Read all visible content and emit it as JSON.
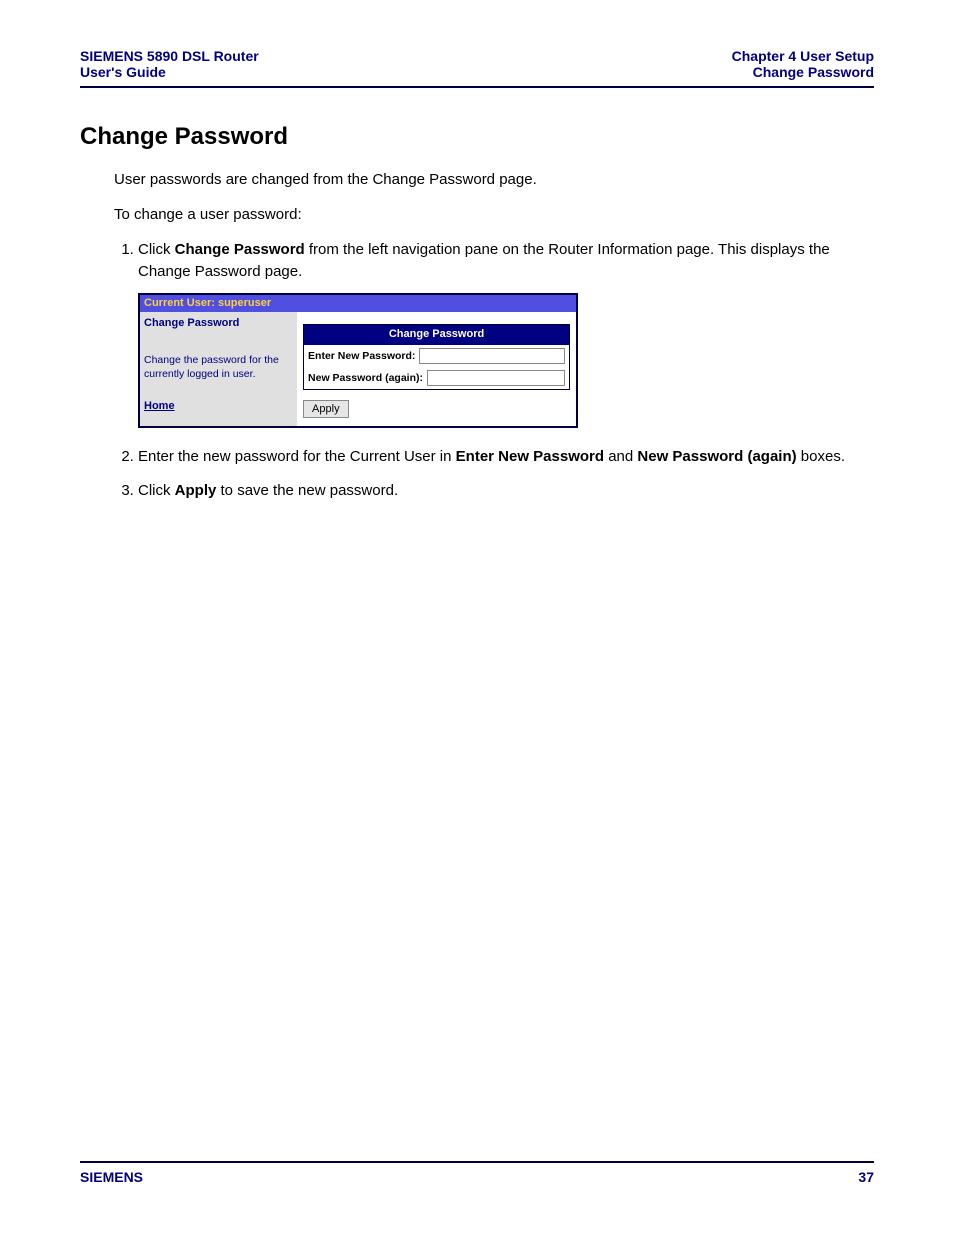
{
  "header": {
    "left_line1": "SIEMENS 5890 DSL Router",
    "left_line2": "User's Guide",
    "right_line1": "Chapter 4  User Setup",
    "right_line2": "Change Password"
  },
  "title": "Change Password",
  "intro1": "User passwords are changed from the Change Password page.",
  "intro2": "To change a user password:",
  "step1_pre": "Click ",
  "step1_bold": "Change Password",
  "step1_post": " from the left navigation pane on the Router Information page. This displays the Change Password page.",
  "router_ui": {
    "topbar": "Current User: superuser",
    "left_title": "Change Password",
    "left_desc": "Change the password for the currently logged in user.",
    "home": "Home",
    "form_title": "Change Password",
    "label_new": "Enter New Password:",
    "label_again": "New Password (again):",
    "apply": "Apply"
  },
  "step2_pre": "Enter the new password for the Current User in ",
  "step2_bold1": "Enter New Password",
  "step2_mid": " and ",
  "step2_bold2": "New Password (again)",
  "step2_post": " boxes.",
  "step3_pre": "Click ",
  "step3_bold": "Apply",
  "step3_post": " to save the new password.",
  "footer": {
    "left": "SIEMENS",
    "right": "37"
  }
}
